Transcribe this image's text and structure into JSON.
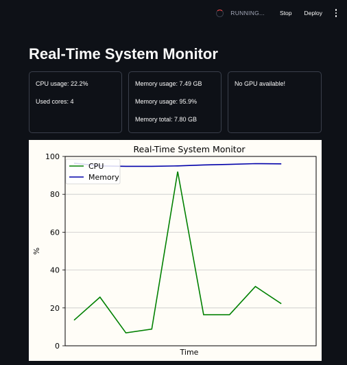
{
  "topbar": {
    "status": "RUNNING...",
    "stop_label": "Stop",
    "deploy_label": "Deploy",
    "menu_icon": "vertical-ellipsis-icon"
  },
  "page": {
    "title": "Real-Time System Monitor"
  },
  "metrics": {
    "cpu": {
      "usage": "CPU usage: 22.2%",
      "cores": "Used cores: 4"
    },
    "memory": {
      "usage_gb": "Memory usage: 7.49 GB",
      "usage_pct": "Memory usage: 95.9%",
      "total": "Memory total: 7.80 GB"
    },
    "gpu": {
      "status": "No GPU available!"
    }
  },
  "colors": {
    "background": "#0e1117",
    "cpu_line": "#008000",
    "memory_line": "#0000aa",
    "spinner": "#ff4b4b",
    "chart_bg": "#fffdf7"
  },
  "chart_data": {
    "type": "line",
    "title": "Real-Time System Monitor",
    "xlabel": "Time",
    "ylabel": "%",
    "ylim": [
      0,
      100
    ],
    "yticks": [
      0,
      20,
      40,
      60,
      80,
      100
    ],
    "grid": "horizontal",
    "legend": "top-left",
    "x": [
      0,
      1,
      2,
      3,
      4,
      5,
      6,
      7,
      8,
      9
    ],
    "series": [
      {
        "name": "CPU",
        "color": "#008000",
        "values": [
          13.5,
          25.7,
          6.8,
          8.8,
          92.0,
          16.4,
          16.4,
          31.3,
          22.2,
          null
        ]
      },
      {
        "name": "Memory",
        "color": "#0000aa",
        "values": [
          96.4,
          95.0,
          94.8,
          94.8,
          95.0,
          95.5,
          95.8,
          96.2,
          96.1,
          null
        ]
      }
    ]
  }
}
